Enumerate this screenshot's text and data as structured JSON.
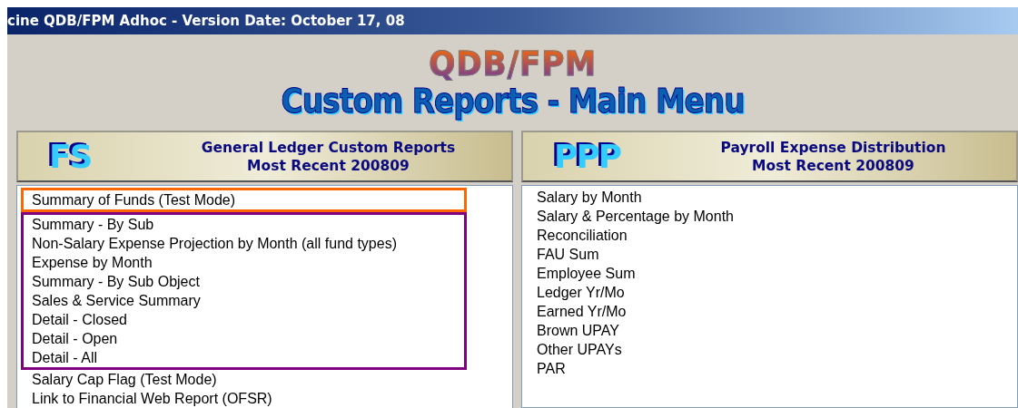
{
  "window": {
    "title": "cine QDB/FPM Adhoc - Version Date: October 17, 08"
  },
  "banner": {
    "logo": "QDB/FPM",
    "title": "Custom Reports - Main Menu"
  },
  "panels": [
    {
      "badge": "FS",
      "heading": "General Ledger Custom Reports",
      "subheading": "Most Recent 200809",
      "groups": [
        {
          "color": "#ff6600",
          "items": [
            "Summary of Funds (Test Mode)"
          ]
        },
        {
          "color": "#800080",
          "items": [
            "Summary - By Sub",
            "Non-Salary Expense Projection by Month (all fund types)",
            "Expense by Month",
            "Summary - By Sub Object",
            "Sales & Service Summary",
            "Detail - Closed",
            "Detail - Open",
            "Detail - All"
          ]
        },
        {
          "items": [
            "Salary Cap Flag (Test Mode)",
            "Link to Financial Web Report (OFSR)"
          ]
        }
      ]
    },
    {
      "badge": "PPP",
      "heading": "Payroll Expense Distribution",
      "subheading": "Most Recent 200809",
      "groups": [
        {
          "items": [
            "Salary by Month",
            "Salary & Percentage by Month",
            "Reconciliation",
            "FAU Sum",
            "Employee Sum",
            "Ledger Yr/Mo",
            "Earned Yr/Mo",
            "Brown UPAY",
            "Other UPAYs",
            "PAR"
          ]
        }
      ]
    }
  ]
}
